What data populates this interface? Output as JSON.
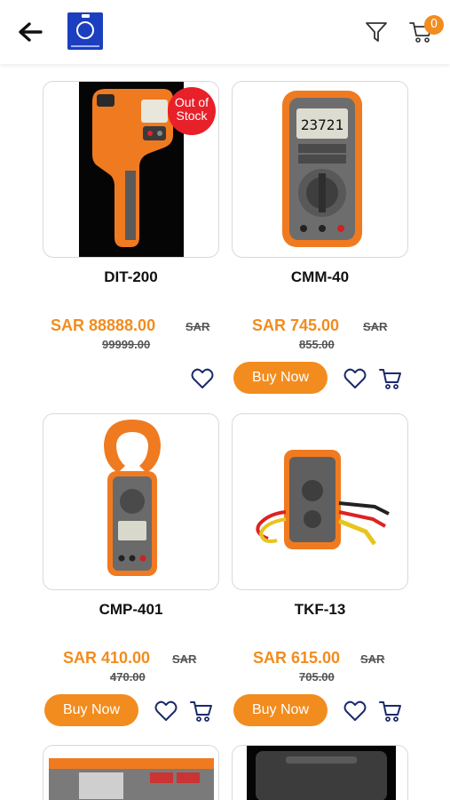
{
  "header": {
    "back_icon": "arrow-left-icon",
    "logo": "store-logo",
    "filter_icon": "filter-icon",
    "cart_icon": "cart-icon",
    "cart_count": "0"
  },
  "products": [
    {
      "name": "DIT-200",
      "price": "SAR 88888.00",
      "sar": "SAR",
      "old_price": "99999.00",
      "out_of_stock": "Out of Stock",
      "has_buy": false
    },
    {
      "name": "CMM-40",
      "price": "SAR 745.00",
      "sar": "SAR",
      "old_price": "855.00",
      "buy_label": "Buy Now",
      "has_buy": true
    },
    {
      "name": "CMP-401",
      "price": "SAR 410.00",
      "sar": "SAR",
      "old_price": "470.00",
      "buy_label": "Buy Now",
      "has_buy": true
    },
    {
      "name": "TKF-13",
      "price": "SAR 615.00",
      "sar": "SAR",
      "old_price": "705.00",
      "buy_label": "Buy Now",
      "has_buy": true
    }
  ],
  "colors": {
    "accent": "#f28c1e",
    "badge_red": "#e8202a"
  }
}
